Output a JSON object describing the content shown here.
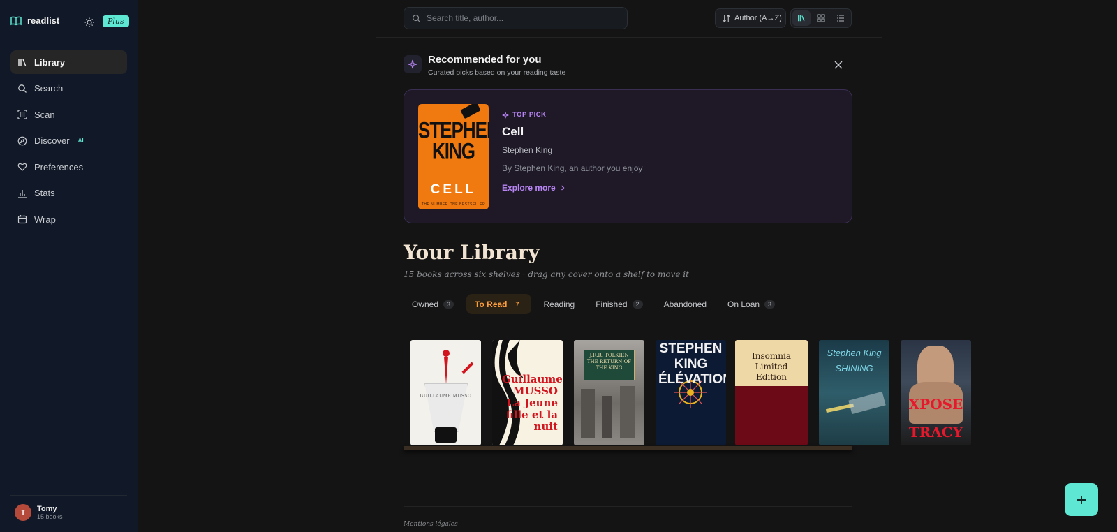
{
  "app": {
    "name": "readlist",
    "plan_badge": "Plus"
  },
  "sidebar": {
    "items": [
      {
        "label": "Library",
        "icon": "library-icon",
        "active": true
      },
      {
        "label": "Search",
        "icon": "search-icon"
      },
      {
        "label": "Scan",
        "icon": "scan-icon"
      },
      {
        "label": "Discover",
        "icon": "compass-icon",
        "tag": "AI"
      },
      {
        "label": "Preferences",
        "icon": "heart-icon"
      },
      {
        "label": "Stats",
        "icon": "bar-chart-icon"
      },
      {
        "label": "Wrap",
        "icon": "calendar-icon"
      }
    ],
    "user": {
      "initial": "T",
      "name": "Tomy",
      "subtitle": "15 books"
    }
  },
  "topbar": {
    "search_placeholder": "Search title, author...",
    "sort_label": "Author (A→Z)"
  },
  "recommended": {
    "title": "Recommended for you",
    "subtitle": "Curated picks based on your reading taste",
    "badge": "TOP PICK",
    "book_title": "Cell",
    "book_author": "Stephen King",
    "reason": "By Stephen King, an author you enjoy",
    "cta": "Explore more",
    "cover": {
      "author_text": "STEPHEN KING",
      "title_text": "CELL",
      "foot_text": "THE NUMBER ONE BESTSELLER"
    }
  },
  "library": {
    "title": "Your Library",
    "subtitle": "15 books across six shelves · drag any cover onto a shelf to move it",
    "tabs": [
      {
        "label": "Owned",
        "count": "3"
      },
      {
        "label": "To Read",
        "count": "7",
        "active": true
      },
      {
        "label": "Reading",
        "count": ""
      },
      {
        "label": "Finished",
        "count": "2"
      },
      {
        "label": "Abandoned",
        "count": ""
      },
      {
        "label": "On Loan",
        "count": "3"
      }
    ],
    "books": [
      {
        "cover_text": "GUILLAUME MUSSO"
      },
      {
        "cover_text": "Guillaume MUSSO La Jeune fille et la nuit"
      },
      {
        "cover_text": "J.R.R. TOLKIEN THE RETURN OF THE KING"
      },
      {
        "cover_text": "STEPHEN KING ÉLÉVATION"
      },
      {
        "cover_text": "Insomnia Limited Edition"
      },
      {
        "cover_text": "Stephen King SHINING"
      },
      {
        "cover_text": "XPOSE TRACY WOL"
      }
    ]
  },
  "footer": {
    "legal": "Mentions légales"
  },
  "colors": {
    "accent": "#5ee7d3",
    "purple": "#b986f5",
    "orange": "#ff9f3a"
  }
}
